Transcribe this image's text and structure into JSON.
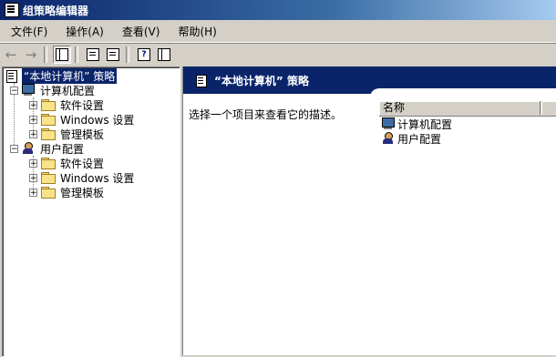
{
  "window": {
    "title": "组策略编辑器"
  },
  "menu": [
    {
      "label": "文件(F)"
    },
    {
      "label": "操作(A)"
    },
    {
      "label": "查看(V)"
    },
    {
      "label": "帮助(H)"
    }
  ],
  "toolbar": {
    "icons": [
      "back-arrow-icon",
      "forward-arrow-icon",
      "show-hide-tree-icon",
      "properties-icon",
      "export-list-icon",
      "help-icon",
      "console-tree-icon"
    ]
  },
  "tree": {
    "root": "“本地计算机” 策略",
    "computer": {
      "label": "计算机配置",
      "children": [
        "软件设置",
        "Windows 设置",
        "管理模板"
      ]
    },
    "user": {
      "label": "用户配置",
      "children": [
        "软件设置",
        "Windows 设置",
        "管理模板"
      ]
    }
  },
  "right": {
    "header": "“本地计算机” 策略",
    "description": "选择一个项目来查看它的描述。",
    "column_name": "名称",
    "items": [
      "计算机配置",
      "用户配置"
    ]
  },
  "colors": {
    "title_bar": "#0a246a",
    "face": "#d4d0c8",
    "selection": "#0a246a"
  }
}
